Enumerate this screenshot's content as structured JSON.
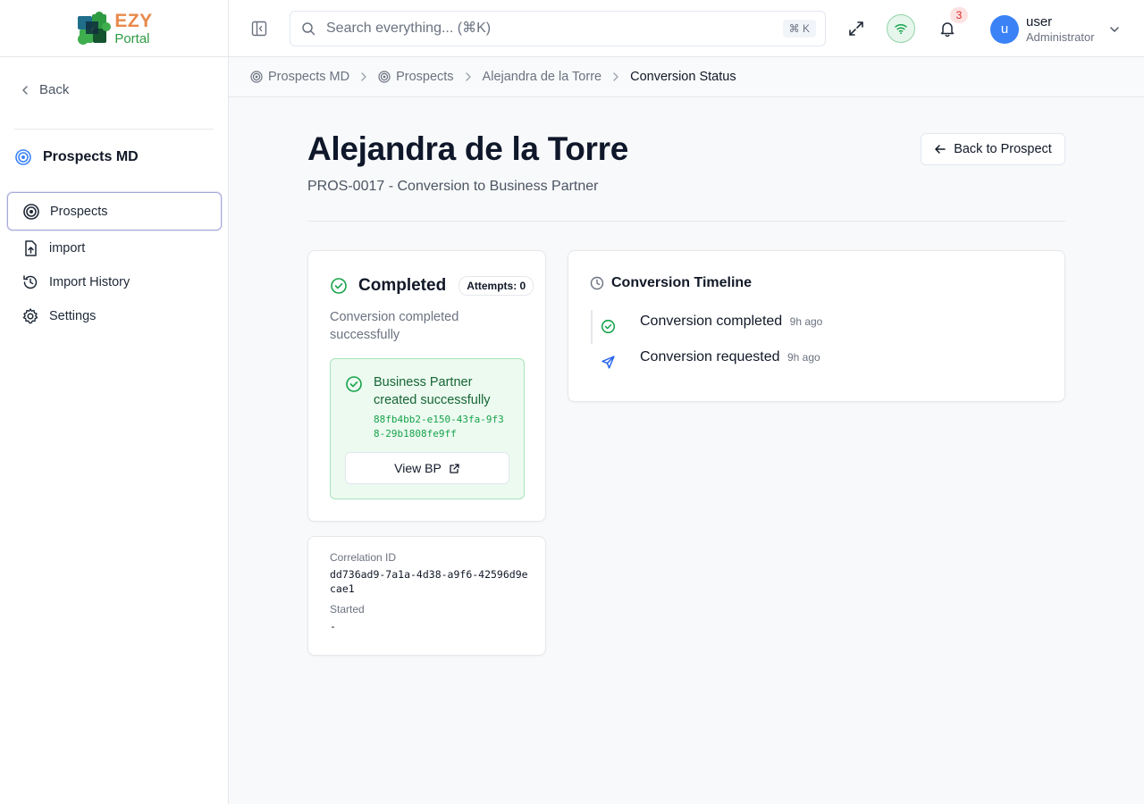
{
  "brand": {
    "ezy": "EZY",
    "portal": "Portal"
  },
  "sidebar": {
    "back_label": "Back",
    "module_title": "Prospects MD",
    "items": [
      {
        "label": "Prospects",
        "icon": "target-icon",
        "active": true
      },
      {
        "label": "import",
        "icon": "file-upload-icon"
      },
      {
        "label": "Import History",
        "icon": "history-icon"
      },
      {
        "label": "Settings",
        "icon": "gear-icon"
      }
    ]
  },
  "header": {
    "search_placeholder": "Search everything... (⌘K)",
    "search_shortcut": "⌘ K",
    "notification_count": "3",
    "user": {
      "initial": "u",
      "name": "user",
      "role": "Administrator"
    }
  },
  "breadcrumb": [
    {
      "label": "Prospects MD"
    },
    {
      "label": "Prospects"
    },
    {
      "label": "Alejandra de la Torre"
    },
    {
      "label": "Conversion Status"
    }
  ],
  "page": {
    "title": "Alejandra de la Torre",
    "subtitle": "PROS-0017 - Conversion to Business Partner",
    "back_button": "Back to Prospect"
  },
  "status_card": {
    "status": "Completed",
    "attempts": "Attempts: 0",
    "description": "Conversion completed successfully",
    "success_title": "Business Partner created successfully",
    "bp_id": "88fb4bb2-e150-43fa-9f38-29b1808fe9ff",
    "view_button": "View BP"
  },
  "meta": {
    "correlation_label": "Correlation ID",
    "correlation_value": "dd736ad9-7a1a-4d38-a9f6-42596d9ecae1",
    "started_label": "Started",
    "started_value": "-"
  },
  "timeline": {
    "title": "Conversion Timeline",
    "items": [
      {
        "title": "Conversion completed",
        "time": "9h ago",
        "icon": "check-circle-icon"
      },
      {
        "title": "Conversion requested",
        "time": "9h ago",
        "icon": "send-icon"
      }
    ]
  },
  "colors": {
    "success": "#16a34a",
    "accent": "#3b82f6",
    "brand_orange": "#e8894b",
    "brand_green": "#2e9a42"
  }
}
